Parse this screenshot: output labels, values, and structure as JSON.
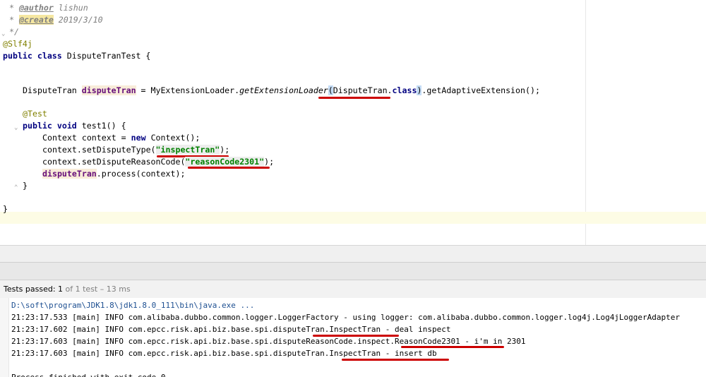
{
  "editor": {
    "lines": {
      "l1": {
        "star": " * ",
        "tag": "@author",
        "rest": " lishun"
      },
      "l2": {
        "star": " * ",
        "tag": "@create",
        "rest": " 2019/3/10"
      },
      "l3": " */",
      "l4": "@Slf4j",
      "l5": {
        "kw": "public class",
        "rest": " DisputeTranTest {"
      },
      "l6": {
        "type": "DisputeTran ",
        "field": "disputeTran",
        "eq": " = MyExtensionLoader.",
        "method": "getExtensionLoader",
        "open": "(",
        "arg": "DisputeTran.",
        "cls": "class",
        "close": ")",
        "tail": ".getAdaptiveExtension();"
      },
      "l7": "@Test",
      "l8": {
        "kw": "public void",
        "rest": " test1() {"
      },
      "l9": {
        "a": "Context context = ",
        "kw": "new",
        "b": " Context();"
      },
      "l10": {
        "a": "context.setDisputeType(",
        "str": "\"inspectTran\"",
        "b": ");"
      },
      "l11": {
        "a": "context.setDisputeReasonCode(",
        "str": "\"reasonCode2301\"",
        "b": ");"
      },
      "l12": {
        "field": "disputeTran",
        "b": ".process(context);"
      },
      "l13": "}",
      "l14": "}"
    }
  },
  "test_status": {
    "prefix": "Tests passed: ",
    "count": "1",
    "suffix": " of 1 test – 13 ms"
  },
  "console": {
    "lines": [
      "D:\\soft\\program\\JDK1.8\\jdk1.8.0_111\\bin\\java.exe ...",
      "21:23:17.533 [main] INFO com.alibaba.dubbo.common.logger.LoggerFactory - using logger: com.alibaba.dubbo.common.logger.log4j.Log4jLoggerAdapter",
      "21:23:17.602 [main] INFO com.epcc.risk.api.biz.base.spi.disputeTran.InspectTran - deal inspect",
      "21:23:17.603 [main] INFO com.epcc.risk.api.biz.base.spi.disputeReasonCode.inspect.ReasonCode2301 - i'm in 2301",
      "21:23:17.603 [main] INFO com.epcc.risk.api.biz.base.spi.disputeTran.InspectTran - insert db",
      "",
      "Process finished with exit code 0"
    ]
  },
  "colors": {
    "keyword": "#000080",
    "string": "#008000",
    "annotation": "#808000",
    "field": "#660e7a",
    "comment": "#808080",
    "red_underline": "#cc0000"
  }
}
